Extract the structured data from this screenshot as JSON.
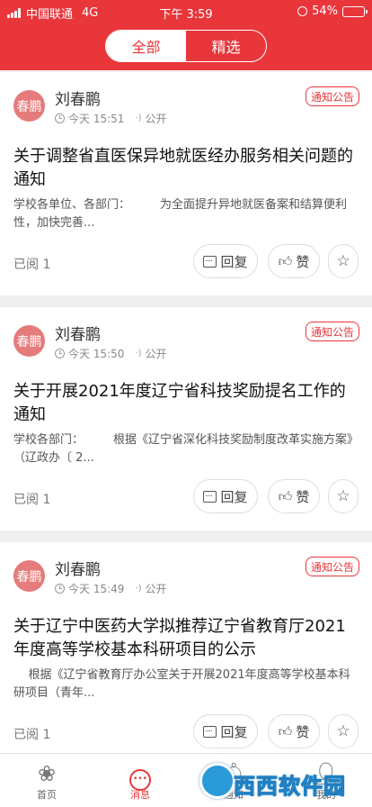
{
  "status_bar": {
    "carrier": "中国联通",
    "network": "4G",
    "time": "下午 3:59",
    "battery": "54%",
    "battery_level": 0.54
  },
  "segment": {
    "tabs": [
      "全部",
      "精选"
    ],
    "active": 0
  },
  "posts": [
    {
      "avatar_text": "春鹏",
      "author": "刘春鹏",
      "time": "今天 15:51",
      "visibility": "公开",
      "badge": "通知公告",
      "title": "关于调整省直医保异地就医经办服务相关问题的通知",
      "excerpt": "学校各单位、各部门：        为全面提升异地就医备案和结算便利性，加快完善...",
      "read": "已阅 1",
      "reply_label": "回复",
      "like_label": "赞"
    },
    {
      "avatar_text": "春鹏",
      "author": "刘春鹏",
      "time": "今天 15:50",
      "visibility": "公开",
      "badge": "通知公告",
      "title": "关于开展2021年度辽宁省科技奖励提名工作的通知",
      "excerpt": "学校各部门：        根据《辽宁省深化科技奖励制度改革实施方案》（辽政办〔 2...",
      "read": "已阅 1",
      "reply_label": "回复",
      "like_label": "赞"
    },
    {
      "avatar_text": "春鹏",
      "author": "刘春鹏",
      "time": "今天 15:49",
      "visibility": "公开",
      "badge": "通知公告",
      "title": "关于辽宁中医药大学拟推荐辽宁省教育厅2021年度高等学校基本科研项目的公示",
      "excerpt": "    根据《辽宁省教育厅办公室关于开展2021年度高等学校基本科研项目（青年...",
      "read": "已阅 1",
      "reply_label": "回复",
      "like_label": "赞"
    }
  ],
  "tabbar": [
    {
      "label": "首页",
      "icon": "home-grid-icon"
    },
    {
      "label": "消息",
      "icon": "message-bubble-icon"
    },
    {
      "label": "通知",
      "icon": "bell-icon"
    },
    {
      "label": "我的",
      "icon": "person-icon"
    }
  ],
  "watermark": {
    "text": "西西软件园"
  }
}
